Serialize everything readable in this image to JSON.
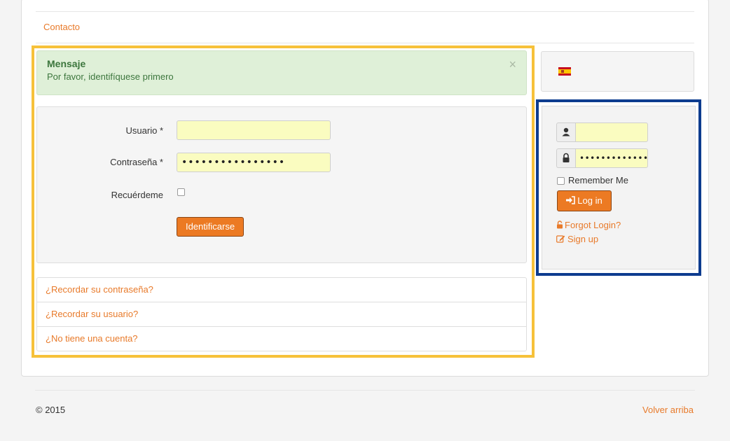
{
  "nav": {
    "contact_label": "Contacto"
  },
  "alert": {
    "title": "Mensaje",
    "text": "Por favor, identifíquese primero",
    "close": "×"
  },
  "login_form": {
    "username_label": "Usuario *",
    "username_value": "",
    "password_label": "Contraseña *",
    "password_value": "••••••••••••••••",
    "remember_label": "Recuérdeme",
    "remember_checked": false,
    "submit_label": "Identificarse"
  },
  "links": [
    {
      "label": "¿Recordar su contraseña?"
    },
    {
      "label": "¿Recordar su usuario?"
    },
    {
      "label": "¿No tiene una cuenta?"
    }
  ],
  "language": {
    "flag": "spain-flag-icon"
  },
  "login_module": {
    "username_icon": "user-icon",
    "username_value": "",
    "password_icon": "lock-icon",
    "password_value": "••••••••••••••",
    "remember_label": "Remember Me",
    "login_label": "Log in",
    "login_icon": "sign-in-icon",
    "forgot_label": "Forgot Login?",
    "forgot_icon": "unlock-icon",
    "signup_label": "Sign up",
    "signup_icon": "edit-icon"
  },
  "footer": {
    "copyright": "© 2015",
    "back_to_top": "Volver arriba"
  },
  "colors": {
    "accent": "#e87a2a",
    "highlight_yellow": "#f6c13a",
    "highlight_blue": "#0d3c8f",
    "alert_bg": "#dff0d8",
    "input_bg": "#fafcc0"
  }
}
